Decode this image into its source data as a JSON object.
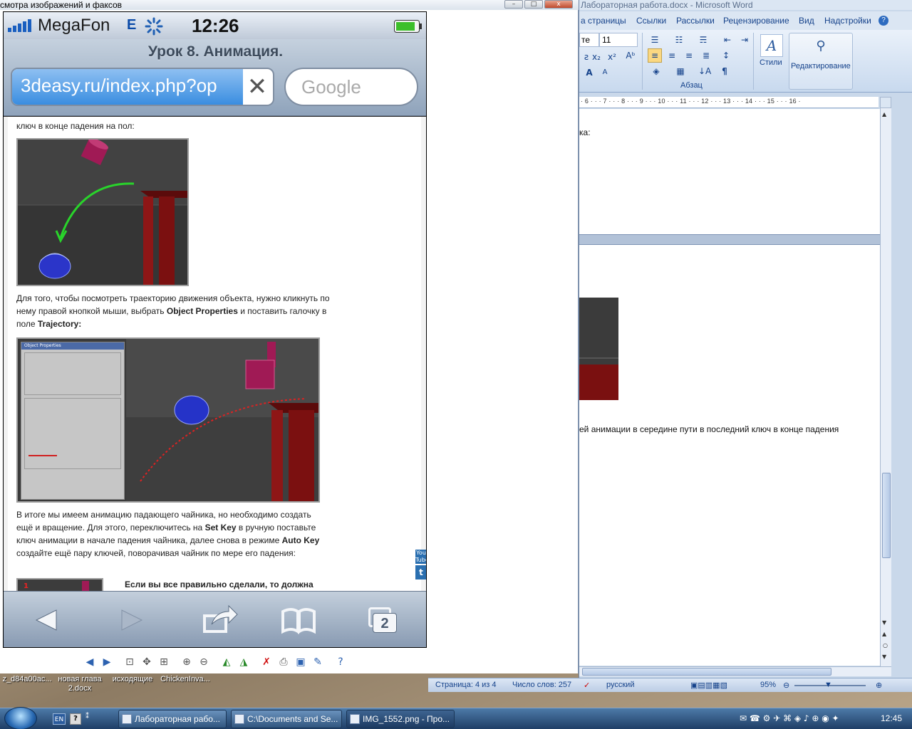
{
  "viewer": {
    "title": "смотра изображений и факсов",
    "min_label": "–",
    "max_label": "□",
    "close_label": "x"
  },
  "phone": {
    "status": {
      "carrier": "MegaFon",
      "network": "E",
      "time": "12:26"
    },
    "page_title": "Урок 8. Анимация.",
    "url": "3deasy.ru/index.php?op",
    "url_clear": "✕",
    "search_placeholder": "Google",
    "content": {
      "text_top": "ключ в конце падения на пол:",
      "para1_a": "Для того, чтобы посмотреть траекторию движения объекта, нужно кликнуть по нему правой кнопкой мыши, выбрать ",
      "para1_b": "Object Properties",
      "para1_c": " и поставить галочку в поле ",
      "para1_d": "Trajectory:",
      "para2_a": "В итоге мы имеем анимацию падающего чайника, но необходимо создать ещё и вращение. Для этого, переключитесь на ",
      "para2_b": "Set Key",
      "para2_c": " в ручную поставьте ключ анимации в начале падения чайника, далее снова в режиме ",
      "para2_d": "Auto Key",
      "para2_e": " создайте ещё пару ключей, поворачивая чайник по мере его падения:",
      "para3": "Если вы все правильно сделали, то должна",
      "dialog_title": "Object Properties"
    },
    "toolbar": {
      "tabs_count": "2"
    }
  },
  "word": {
    "title": "Лабораторная работа.docx - Microsoft Word",
    "tabs": [
      "а страницы",
      "Ссылки",
      "Рассылки",
      "Рецензирование",
      "Вид",
      "Надстройки"
    ],
    "font_name": "те",
    "font_size": "11",
    "groups": {
      "paragraph": "Абзац",
      "styles": "Стили",
      "editing": "Редактирование"
    },
    "ruler": "· 6 · · · 7 · · · 8 · · · 9 · · · 10 · · · 11 · · · 12 · · · 13 · · · 14 · · · 15 · · · 16 ·",
    "doc_text_1": "ка:",
    "doc_text_2": "ей анимации в середине пути  в последний ключ в конце падения",
    "status": {
      "page": "Страница: 4 из 4",
      "words": "Число слов: 257",
      "lang": "русский",
      "zoom": "95%"
    }
  },
  "desktop": {
    "icons": [
      "z_d84a00ac...",
      "новая глава 2.docx",
      "исходящие",
      "ChickenInva..."
    ]
  },
  "taskbar": {
    "lang": "EN",
    "tasks": [
      "Лабораторная рабо...",
      "C:\\Documents and Se...",
      "IMG_1552.png - Про..."
    ],
    "time": "12:45"
  }
}
